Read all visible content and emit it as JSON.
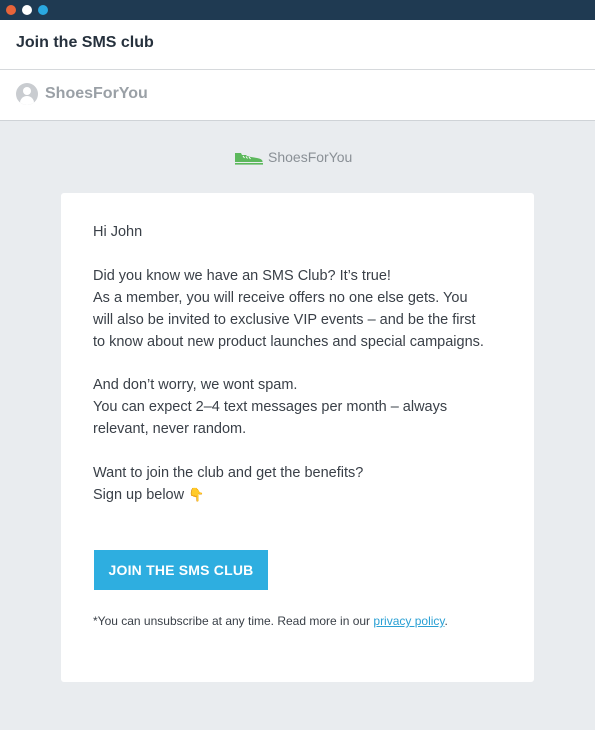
{
  "window": {
    "dot_colors": [
      "#e8643a",
      "#ffffff",
      "#2aa8e0"
    ]
  },
  "email": {
    "subject": "Join the SMS club",
    "sender": "ShoesForYou"
  },
  "brand": {
    "name": "ShoesForYou",
    "icon": "shoe-icon",
    "color": "#5cb85c"
  },
  "body": {
    "greeting": "Hi John",
    "para1": [
      "Did you know we have an SMS Club? It’s true!",
      "As a member, you will receive offers no one else gets. You",
      "will also be invited to exclusive VIP events – and be the first",
      "to know about new product launches and special campaigns."
    ],
    "para2": [
      "And don’t worry, we wont spam.",
      "You can expect 2–4 text messages per month – always",
      "relevant, never random."
    ],
    "para3": [
      "Want to join the club and get the benefits?",
      "Sign up below"
    ],
    "pointing_emoji": "👇",
    "cta_label": "JOIN THE SMS CLUB",
    "cta_color": "#2eaee0",
    "footnote_text": "*You can unsubscribe at any time. Read more in our ",
    "footnote_link": "privacy policy",
    "footnote_end": "."
  }
}
